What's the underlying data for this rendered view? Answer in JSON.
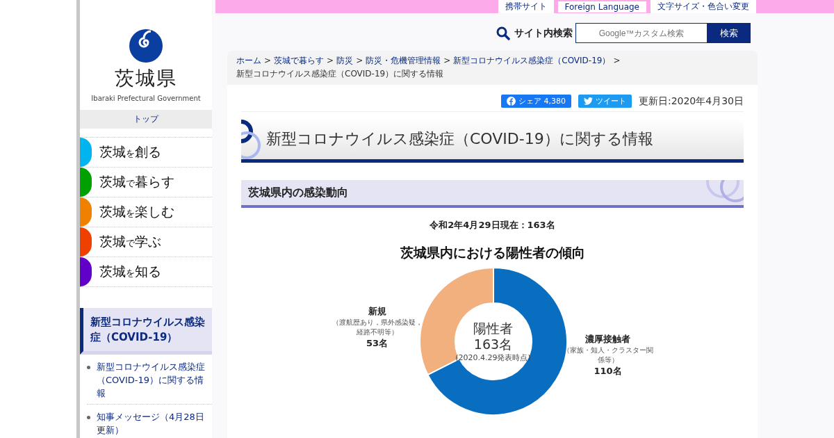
{
  "header": {
    "utility_links": [
      "携帯サイト",
      "Foreign Language",
      "文字サイズ・色合い変更"
    ],
    "search": {
      "label": "サイト内検索",
      "placeholder": "Google™カスタム検索",
      "button": "検索"
    }
  },
  "sidebar": {
    "logo": {
      "name": "茨城県",
      "subtitle": "Ibaraki Prefectural Government"
    },
    "top_link": "トップ",
    "nav": [
      {
        "prefix": "茨城",
        "particle": "を",
        "rest": "創る",
        "color": "#00b4f0"
      },
      {
        "prefix": "茨城",
        "particle": "で",
        "rest": "暮らす",
        "color": "#00a000"
      },
      {
        "prefix": "茨城",
        "particle": "を",
        "rest": "楽しむ",
        "color": "#f08000"
      },
      {
        "prefix": "茨城",
        "particle": "で",
        "rest": "学ぶ",
        "color": "#f04000"
      },
      {
        "prefix": "茨城",
        "particle": "を",
        "rest": "知る",
        "color": "#6000c8"
      }
    ],
    "section_title": "新型コロナウイルス感染症（COVID-19）",
    "section_links": [
      "新型コロナウイルス感染症（COVID-19）に関する情報",
      "知事メッセージ（4月28日更新）"
    ]
  },
  "breadcrumb": {
    "separator": ">",
    "links": [
      "ホーム",
      "茨城で暮らす",
      "防災",
      "防災・危機管理情報",
      "新型コロナウイルス感染症（COVID-19）"
    ],
    "current": "新型コロナウイルス感染症（COVID-19）に関する情報"
  },
  "share": {
    "facebook": "シェア",
    "facebook_count": "4,380",
    "twitter": "ツイート",
    "updated": "更新日:2020年4月30日"
  },
  "page_title": "新型コロナウイルス感染症（COVID-19）に関する情報",
  "section": {
    "heading": "茨城県内の感染動向",
    "as_of": "令和2年4月29日現在：163名",
    "chart_data": {
      "type": "donut",
      "title": "茨城県内における陽性者の傾向",
      "categories": [
        "新規",
        "濃厚接触者"
      ],
      "values": [
        53,
        110
      ],
      "value_labels": [
        "53名",
        "110名"
      ]
    },
    "slice_notes": [
      "（渡航歴あり，県外感染疑，経路不明等）",
      "（家族・知人・クラスター関係等）"
    ],
    "center": {
      "label": "陽性者",
      "total": "163名",
      "note": "(2020.4.29発表時点)"
    }
  }
}
